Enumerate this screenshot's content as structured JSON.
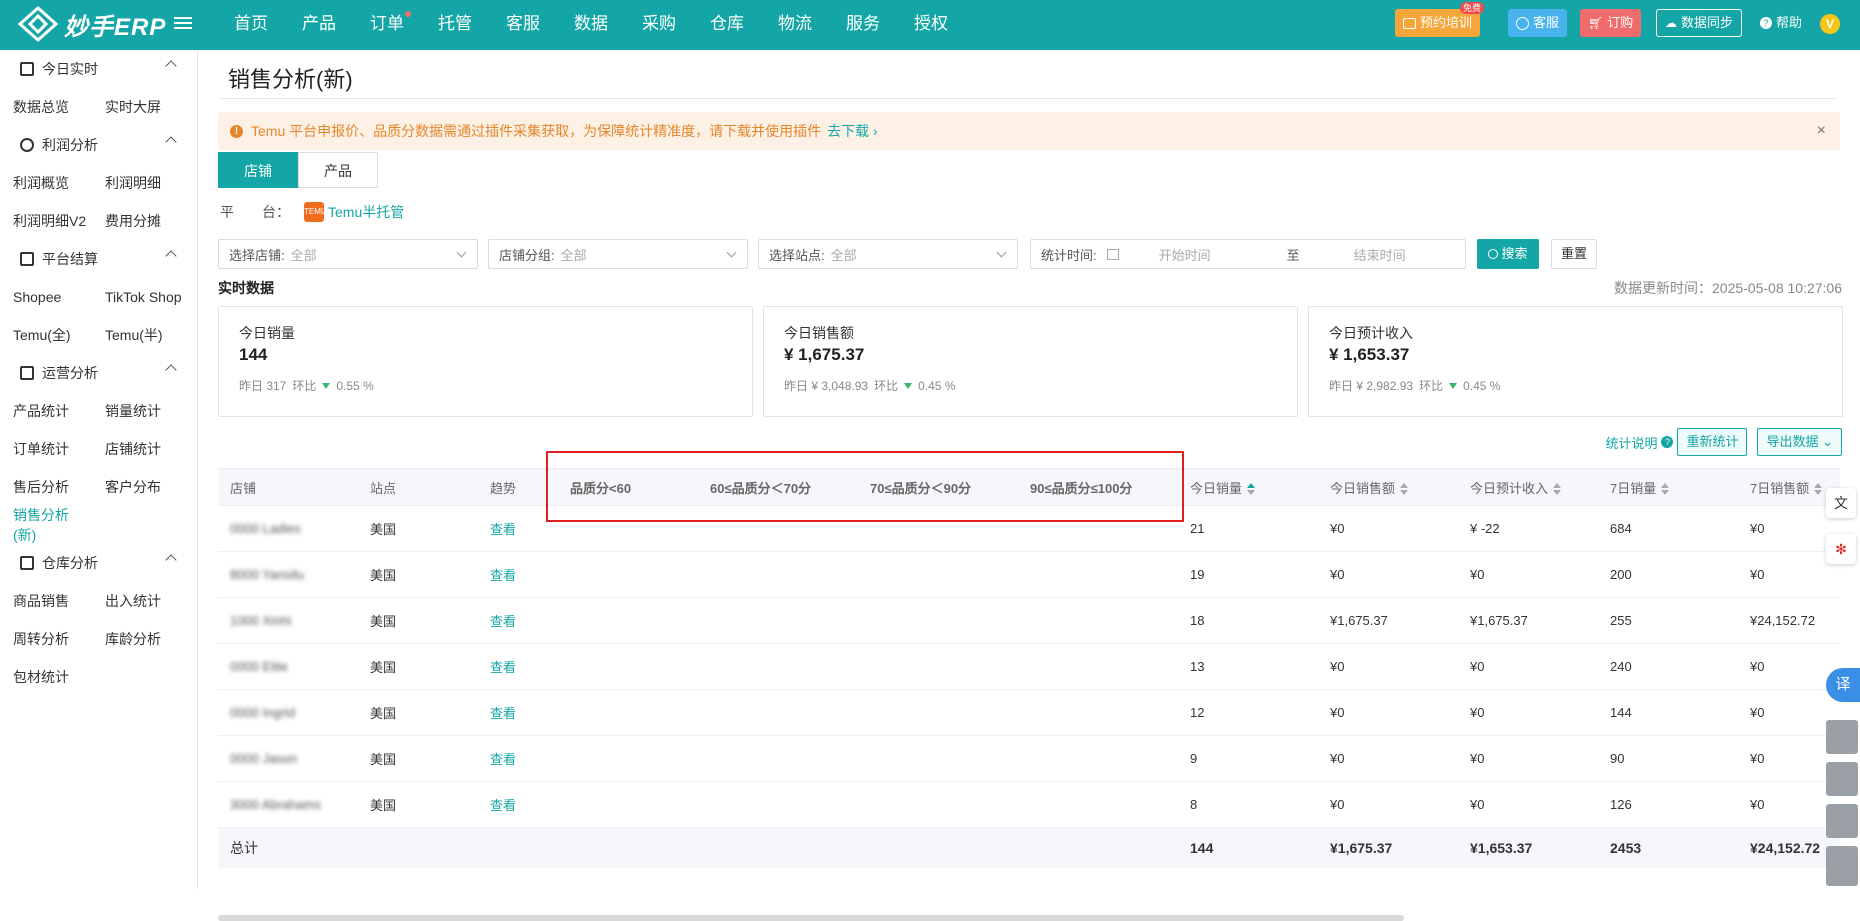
{
  "topbar": {
    "logo_text": "妙手ERP",
    "nav": [
      {
        "label": "首页",
        "dot": false
      },
      {
        "label": "产品",
        "dot": false
      },
      {
        "label": "订单",
        "dot": true
      },
      {
        "label": "托管",
        "dot": false
      },
      {
        "label": "客服",
        "dot": false
      },
      {
        "label": "数据",
        "dot": false
      },
      {
        "label": "采购",
        "dot": false
      },
      {
        "label": "仓库",
        "dot": false
      },
      {
        "label": "物流",
        "dot": false
      },
      {
        "label": "服务",
        "dot": false
      },
      {
        "label": "授权",
        "dot": false
      }
    ],
    "training_label": "预约培训",
    "free_badge": "免费",
    "service_label": "客服",
    "order_label": "订购",
    "sync_label": "数据同步",
    "help_label": "帮助",
    "avatar_letter": "V",
    "colors": {
      "bar": "#14a6a6",
      "training": "#f5a63a",
      "service": "#49b3ee",
      "order": "#f06b6b"
    }
  },
  "sidebar": {
    "groups": [
      {
        "label": "今日实时",
        "icon": "calendar-icon",
        "items": [
          "数据总览",
          "实时大屏"
        ]
      },
      {
        "label": "利润分析",
        "icon": "yuan-circle-icon",
        "items": [
          "利润概览",
          "利润明细",
          "利润明细V2",
          "费用分摊"
        ]
      },
      {
        "label": "平台结算",
        "icon": "bar-chart-icon",
        "items": [
          "Shopee",
          "TikTok Shop",
          "Temu(全)",
          "Temu(半)"
        ]
      },
      {
        "label": "运营分析",
        "icon": "bar-chart-icon",
        "items": [
          "产品统计",
          "销量统计",
          "订单统计",
          "店铺统计",
          "售后分析",
          "客户分布",
          "销售分析(新)"
        ]
      },
      {
        "label": "仓库分析",
        "icon": "warehouse-icon",
        "items": [
          "商品销售",
          "出入统计",
          "周转分析",
          "库龄分析",
          "包材统计"
        ]
      }
    ],
    "active_item": "销售分析(新)"
  },
  "main": {
    "title": "销售分析(新)",
    "notice": {
      "text": "Temu 平台申报价、品质分数据需通过插件采集获取，为保障统计精准度，请下载并使用插件",
      "link": "去下载",
      "close": "×"
    },
    "tabs": [
      {
        "label": "店铺",
        "active": true
      },
      {
        "label": "产品",
        "active": false
      }
    ],
    "platform": {
      "label": "平　　台：",
      "logo": "TEMU",
      "name": "Temu半托管"
    },
    "filters": [
      {
        "label": "选择店铺:",
        "value": "全部"
      },
      {
        "label": "店铺分组:",
        "value": "全部"
      },
      {
        "label": "选择站点:",
        "value": "全部"
      }
    ],
    "time_filter": {
      "label": "统计时间:",
      "start": "开始时间",
      "sep": "至",
      "end": "结束时间"
    },
    "search_label": "搜索",
    "reset_label": "重置",
    "realtime_label": "实时数据",
    "update_time": "数据更新时间：2025-05-08 10:27:06",
    "cards": [
      {
        "title": "今日销量",
        "value": "144",
        "yesterday": "昨日 317",
        "ratio_label": "环比",
        "ratio": "0.55 %"
      },
      {
        "title": "今日销售额",
        "value": "¥ 1,675.37",
        "yesterday": "昨日 ¥ 3,048.93",
        "ratio_label": "环比",
        "ratio": "0.45 %"
      },
      {
        "title": "今日预计收入",
        "value": "¥ 1,653.37",
        "yesterday": "昨日 ¥ 2,982.93",
        "ratio_label": "环比",
        "ratio": "0.45 %"
      }
    ],
    "stats_note": "统计说明",
    "recalc_label": "重新统计",
    "export_label": "导出数据",
    "table": {
      "headers": [
        "店铺",
        "站点",
        "趋势",
        "品质分<60",
        "60≤品质分＜70分",
        "70≤品质分＜90分",
        "90≤品质分≤100分",
        "今日销量",
        "今日销售额",
        "今日预计收入",
        "7日销量",
        "7日销售额"
      ],
      "rows": [
        [
          "0000 Ladies",
          "美国",
          "查看",
          "",
          "",
          "",
          "",
          "21",
          "¥0",
          "¥ -22",
          "684",
          "¥0"
        ],
        [
          "8000 Yansilu",
          "美国",
          "查看",
          "",
          "",
          "",
          "",
          "19",
          "¥0",
          "¥0",
          "200",
          "¥0"
        ],
        [
          "1000 Xinhi",
          "美国",
          "查看",
          "",
          "",
          "",
          "",
          "18",
          "¥1,675.37",
          "¥1,675.37",
          "255",
          "¥24,152.72"
        ],
        [
          "0000 Elite",
          "美国",
          "查看",
          "",
          "",
          "",
          "",
          "13",
          "¥0",
          "¥0",
          "240",
          "¥0"
        ],
        [
          "0000 Ingrid",
          "美国",
          "查看",
          "",
          "",
          "",
          "",
          "12",
          "¥0",
          "¥0",
          "144",
          "¥0"
        ],
        [
          "0000 Jason",
          "美国",
          "查看",
          "",
          "",
          "",
          "",
          "9",
          "¥0",
          "¥0",
          "90",
          "¥0"
        ],
        [
          "3000 Abrahams",
          "美国",
          "查看",
          "",
          "",
          "",
          "",
          "8",
          "¥0",
          "¥0",
          "126",
          "¥0"
        ]
      ],
      "footer": [
        "总计",
        "",
        "",
        "",
        "",
        "",
        "",
        "144",
        "¥1,675.37",
        "¥1,653.37",
        "2453",
        "¥24,152.72"
      ]
    }
  },
  "floating": {
    "translate_label": "译"
  }
}
